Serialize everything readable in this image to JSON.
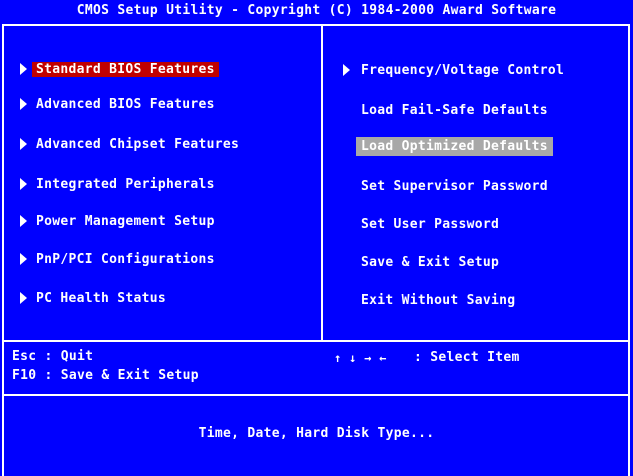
{
  "title": "CMOS Setup Utility - Copyright (C) 1984-2000 Award Software",
  "left_menu": [
    {
      "label": "Standard BIOS Features",
      "selected": true
    },
    {
      "label": "Advanced BIOS Features"
    },
    {
      "label": "Advanced Chipset Features"
    },
    {
      "label": "Integrated Peripherals"
    },
    {
      "label": "Power Management Setup"
    },
    {
      "label": "PnP/PCI Configurations"
    },
    {
      "label": "PC Health Status"
    }
  ],
  "right_menu": [
    {
      "label": "Frequency/Voltage Control",
      "has_submenu": true
    },
    {
      "label": "Load Fail-Safe Defaults"
    },
    {
      "label": "Load Optimized Defaults",
      "highlighted": true
    },
    {
      "label": "Set Supervisor Password"
    },
    {
      "label": "Set User Password"
    },
    {
      "label": "Save & Exit Setup"
    },
    {
      "label": "Exit Without Saving"
    }
  ],
  "help": {
    "esc": "Esc : Quit",
    "f10": "F10 : Save & Exit Setup",
    "arrows": "↑ ↓ → ←",
    "select": ": Select Item"
  },
  "description": "Time, Date, Hard Disk Type...",
  "colors": {
    "background": "#0000ff",
    "selected_item": "#c00000",
    "highlighted_item": "#a8a8a8",
    "text": "#ffffff"
  }
}
